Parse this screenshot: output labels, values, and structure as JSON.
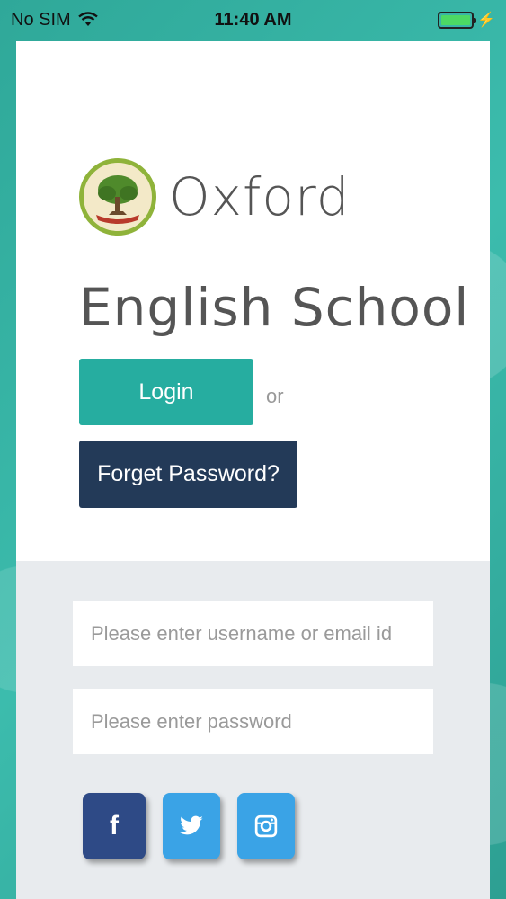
{
  "status_bar": {
    "carrier": "No SIM",
    "time": "11:40 AM",
    "battery_icon": "battery-full-icon",
    "charging_icon": "lightning-bolt-icon"
  },
  "brand": {
    "name_line1": "Oxford",
    "name_line2": "English School",
    "logo_icon": "oak-tree-emblem-icon"
  },
  "actions": {
    "login_label": "Login",
    "or_text": "or",
    "forgot_label": "Forget Password?"
  },
  "form": {
    "username_placeholder": "Please enter username or email id",
    "username_value": "",
    "password_placeholder": "Please enter password",
    "password_value": ""
  },
  "social": {
    "facebook_glyph": "f",
    "twitter_icon": "twitter-bird-icon",
    "instagram_icon": "instagram-camera-icon"
  },
  "colors": {
    "accent": "#26ada0",
    "dark_button": "#233a58",
    "background": "#34b1a3",
    "facebook": "#2e4a86",
    "social_blue": "#3aa3e6"
  }
}
